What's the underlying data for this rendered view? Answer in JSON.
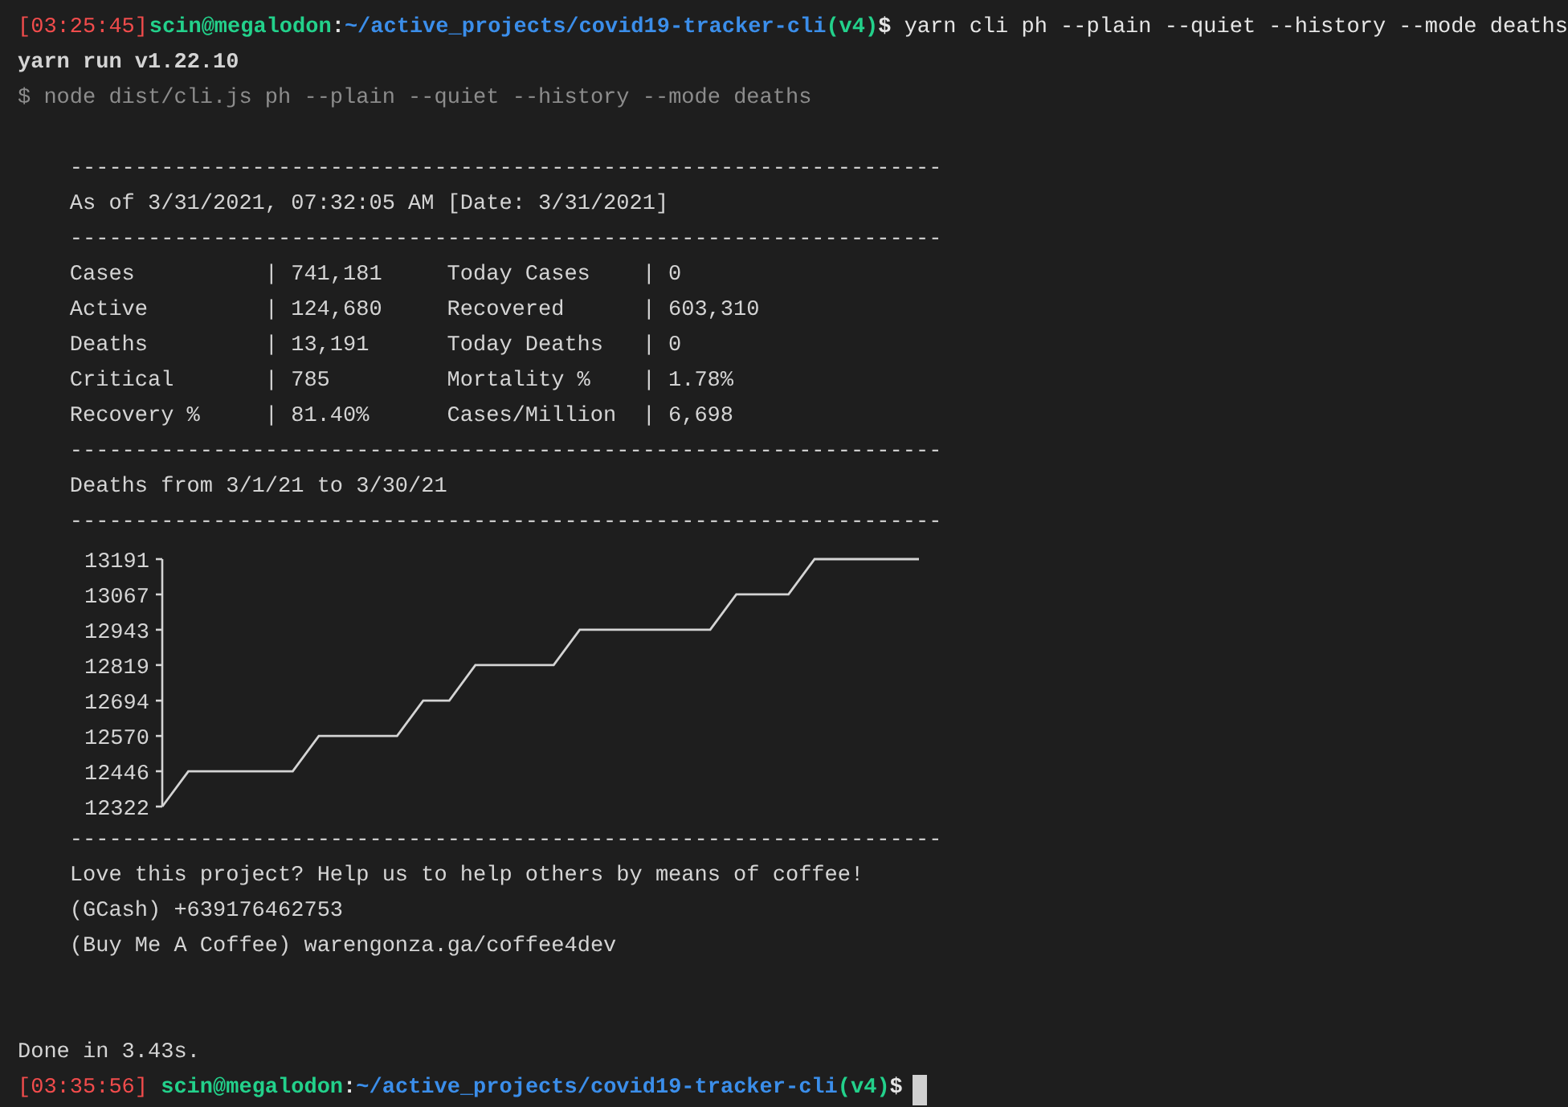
{
  "command_prompt": {
    "time": "[03:25:45]",
    "user": "scin@megalodon",
    "colon": ":",
    "path": "~/active_projects/covid19-tracker-cli",
    "branch": "(v4)",
    "symbol": "$",
    "command": " yarn cli ph --plain --quiet --history --mode deaths"
  },
  "yarn_version": "yarn run v1.22.10",
  "run_command": "$ node dist/cli.js ph --plain --quiet --history --mode deaths",
  "report": [
    {
      "kind": "rule",
      "text": "-------------------------------------------------------------------"
    },
    {
      "kind": "text",
      "text": "As of 3/31/2021, 07:32:05 AM [Date: 3/31/2021]"
    },
    {
      "kind": "rule",
      "text": "-------------------------------------------------------------------"
    },
    {
      "kind": "stats",
      "rows": [
        {
          "cells": [
            {
              "label": "Cases",
              "sep": "|",
              "value": "741,181"
            },
            {
              "label": "Today Cases",
              "sep": "|",
              "value": "0"
            }
          ]
        },
        {
          "cells": [
            {
              "label": "Active",
              "sep": "|",
              "value": "124,680"
            },
            {
              "label": "Recovered",
              "sep": "|",
              "value": "603,310"
            }
          ]
        },
        {
          "cells": [
            {
              "label": "Deaths",
              "sep": "|",
              "value": "13,191"
            },
            {
              "label": "Today Deaths",
              "sep": "|",
              "value": "0"
            }
          ]
        },
        {
          "cells": [
            {
              "label": "Critical",
              "sep": "|",
              "value": "785"
            },
            {
              "label": "Mortality %",
              "sep": "|",
              "value": "1.78%"
            }
          ]
        },
        {
          "cells": [
            {
              "label": "Recovery %",
              "sep": "|",
              "value": "81.40%"
            },
            {
              "label": "Cases/Million",
              "sep": "|",
              "value": "6,698"
            }
          ]
        }
      ]
    },
    {
      "kind": "rule",
      "text": "-------------------------------------------------------------------"
    },
    {
      "kind": "text",
      "text": "Deaths from 3/1/21 to 3/30/21"
    },
    {
      "kind": "rule",
      "text": "-------------------------------------------------------------------"
    },
    {
      "kind": "chart",
      "chart_data": {
        "type": "line",
        "ylim": [
          12322,
          13191
        ],
        "yticks": [
          13191,
          13067,
          12943,
          12819,
          12694,
          12570,
          12446,
          12322
        ],
        "series": [
          {
            "color": "#d4d4d4",
            "values": [
              12322,
              12446,
              12446,
              12446,
              12446,
              12446,
              12570,
              12570,
              12570,
              12570,
              12694,
              12694,
              12819,
              12819,
              12819,
              12819,
              12943,
              12943,
              12943,
              12943,
              12943,
              12943,
              13067,
              13067,
              13067,
              13191,
              13191,
              13191,
              13191,
              13191
            ]
          }
        ]
      }
    },
    {
      "kind": "rule",
      "text": "-------------------------------------------------------------------"
    },
    {
      "kind": "text",
      "text": "Love this project? Help us to help others by means of coffee!"
    },
    {
      "kind": "text",
      "text": "(GCash) +639176462753"
    },
    {
      "kind": "text",
      "text": "(Buy Me A Coffee) warengonza.ga/coffee4dev"
    }
  ],
  "done_message": "Done in 3.43s.",
  "final_prompt": {
    "time": "[03:35:56]",
    "user": "scin@megalodon",
    "colon": ":",
    "path": "~/active_projects/covid19-tracker-cli",
    "branch": "(v4)",
    "symbol": "$"
  }
}
